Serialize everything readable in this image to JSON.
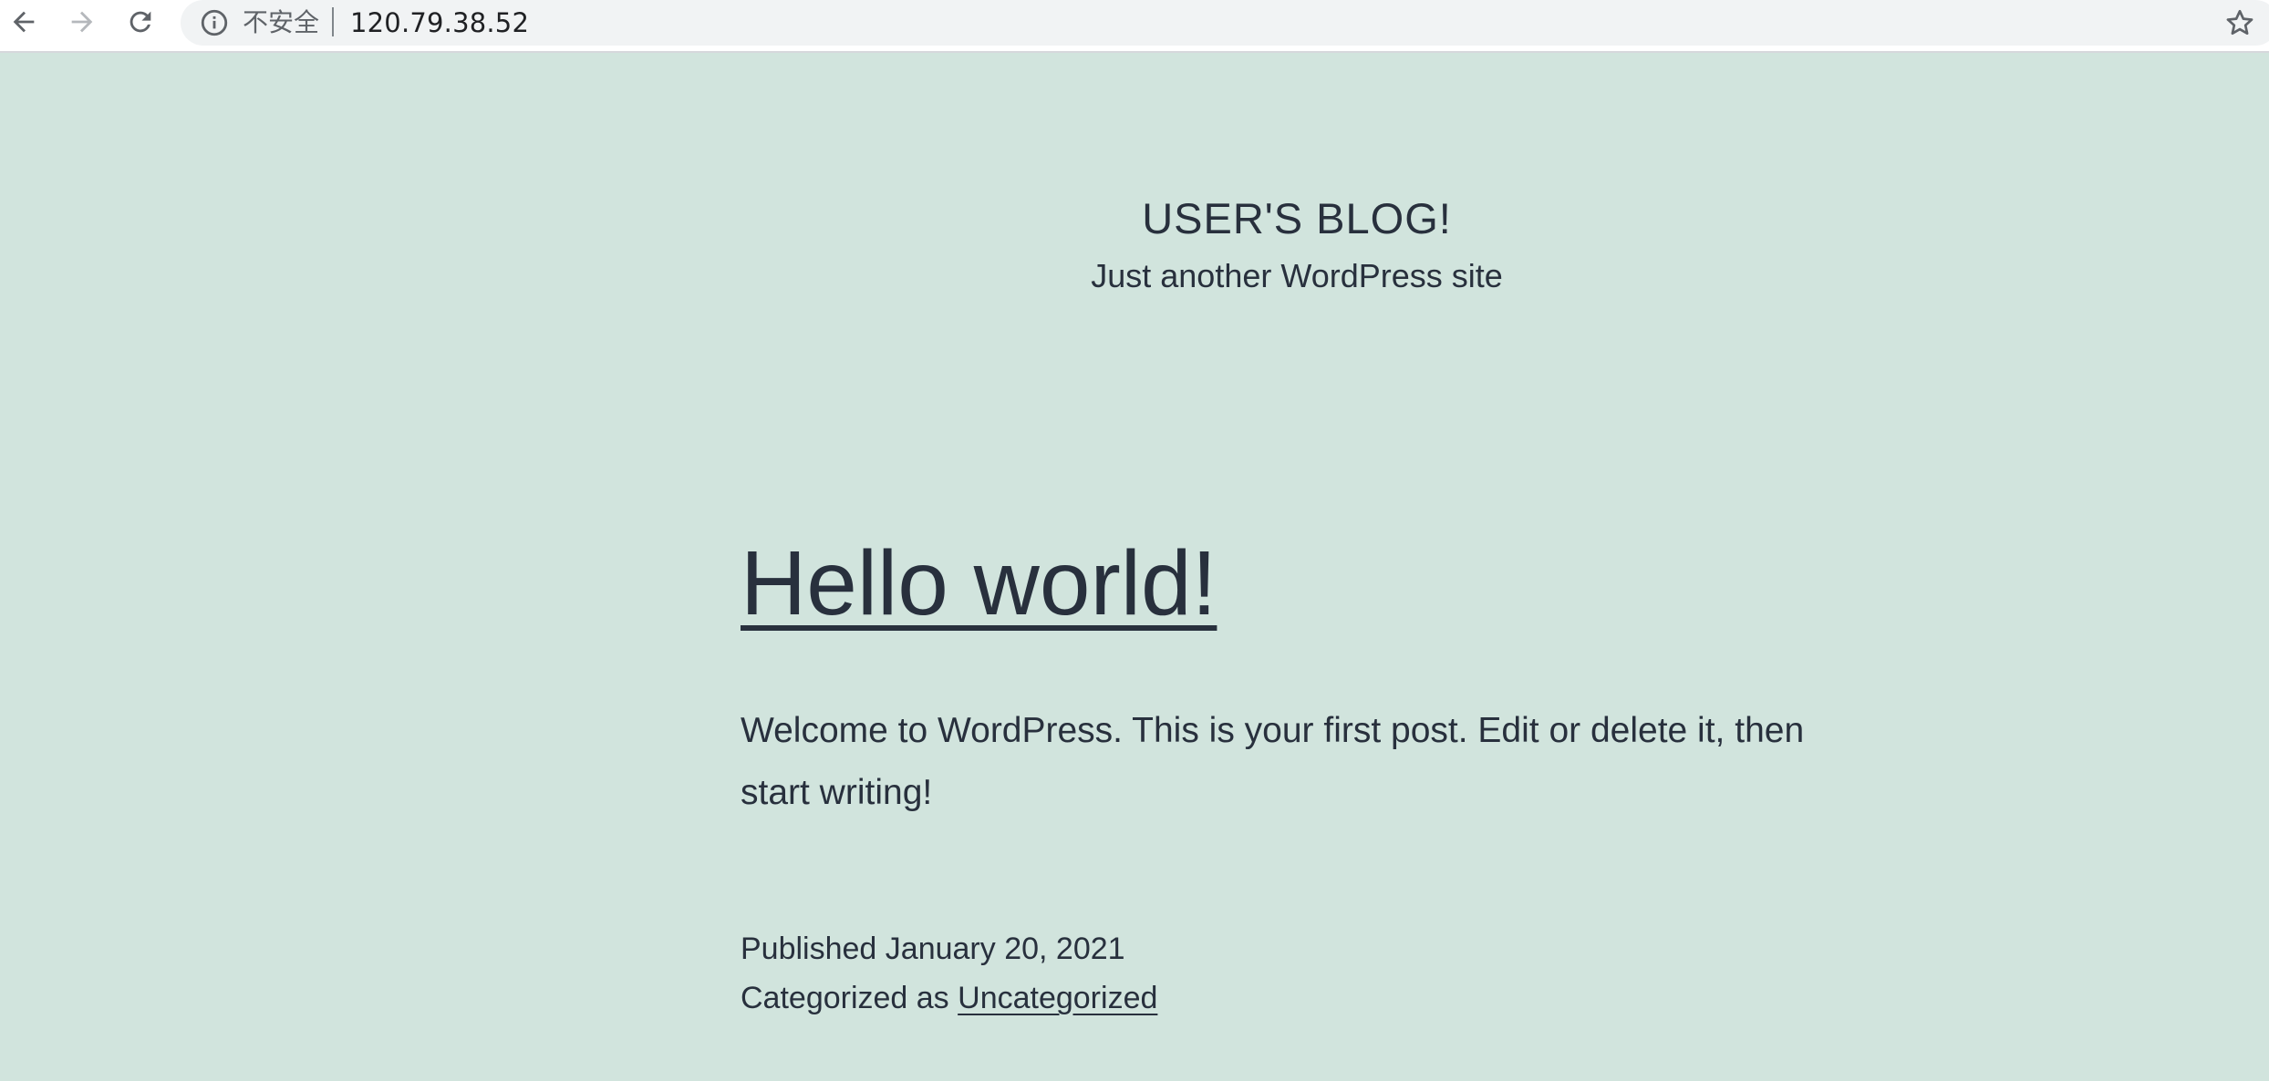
{
  "browser": {
    "security_label": "不安全",
    "url": "120.79.38.52"
  },
  "site": {
    "title": "USER'S BLOG!",
    "description": "Just another WordPress site"
  },
  "post": {
    "title": "Hello world!",
    "content": "Welcome to WordPress. This is your first post. Edit or delete it, then start writing!",
    "published_prefix": "Published",
    "published_date": "January 20, 2021",
    "category_prefix": "Categorized as",
    "category": "Uncategorized"
  },
  "colors": {
    "page_background": "#d1e4dd",
    "text": "#28303d",
    "toolbar": "#ffffff",
    "omnibox": "#f1f3f4"
  },
  "icons": [
    "back-icon",
    "forward-icon",
    "reload-icon",
    "info-icon",
    "translate-icon",
    "star-icon"
  ]
}
